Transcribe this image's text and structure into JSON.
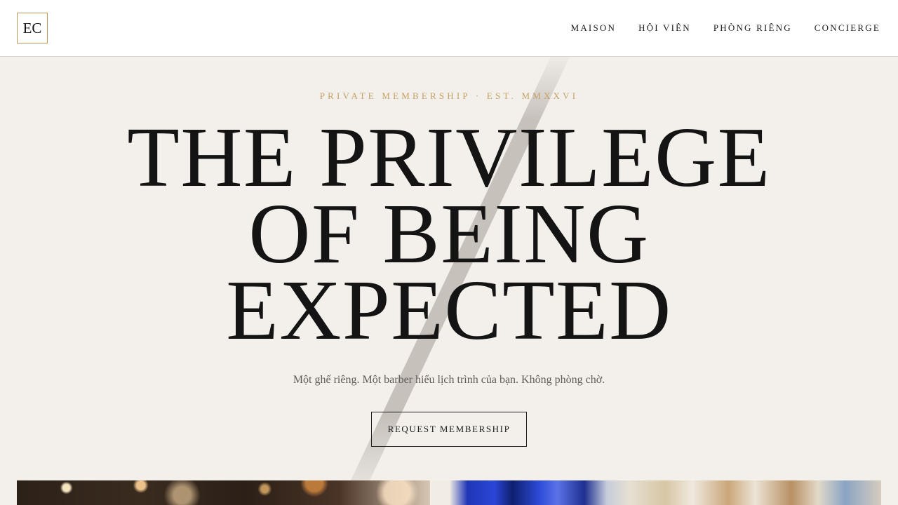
{
  "header": {
    "logo": "EC",
    "nav": [
      "MAISON",
      "HỘI VIÊN",
      "PHÒNG RIÊNG",
      "CONCIERGE"
    ]
  },
  "hero": {
    "eyebrow": "PRIVATE MEMBERSHIP · EST. MMXXVI",
    "headline_lines": [
      "THE PRIVILEGE",
      "OF BEING",
      "EXPECTED"
    ],
    "subtitle": "Một ghế riêng. Một barber hiểu lịch trình của bạn. Không phòng chờ.",
    "cta_label": "REQUEST MEMBERSHIP"
  },
  "colors": {
    "background": "#f3f0eb",
    "accent_gold": "#c3a265",
    "text": "#151515"
  }
}
